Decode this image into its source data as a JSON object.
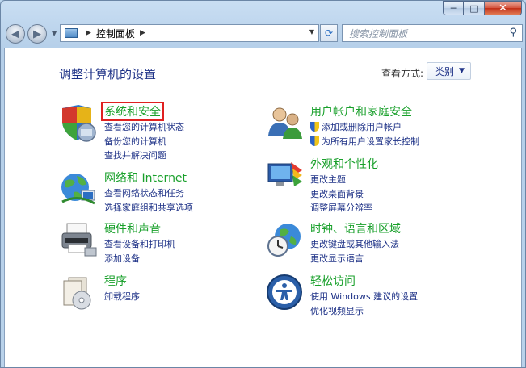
{
  "window": {
    "minimize": "─",
    "maximize": "□",
    "close": "✕"
  },
  "nav": {
    "address": "控制面板",
    "search_placeholder": "搜索控制面板"
  },
  "header": {
    "title": "调整计算机的设置",
    "view_by_label": "查看方式:",
    "view_by_value": "类别"
  },
  "categories": [
    {
      "title": "系统和安全",
      "links": [
        "查看您的计算机状态",
        "备份您的计算机",
        "查找并解决问题"
      ]
    },
    {
      "title": "网络和 Internet",
      "links": [
        "查看网络状态和任务",
        "选择家庭组和共享选项"
      ]
    },
    {
      "title": "硬件和声音",
      "links": [
        "查看设备和打印机",
        "添加设备"
      ]
    },
    {
      "title": "程序",
      "links": [
        "卸载程序"
      ]
    },
    {
      "title": "用户帐户和家庭安全",
      "links": [
        "添加或删除用户帐户",
        "为所有用户设置家长控制"
      ]
    },
    {
      "title": "外观和个性化",
      "links": [
        "更改主题",
        "更改桌面背景",
        "调整屏幕分辨率"
      ]
    },
    {
      "title": "时钟、语言和区域",
      "links": [
        "更改键盘或其他输入法",
        "更改显示语言"
      ]
    },
    {
      "title": "轻松访问",
      "links": [
        "使用 Windows 建议的设置",
        "优化视频显示"
      ]
    }
  ]
}
